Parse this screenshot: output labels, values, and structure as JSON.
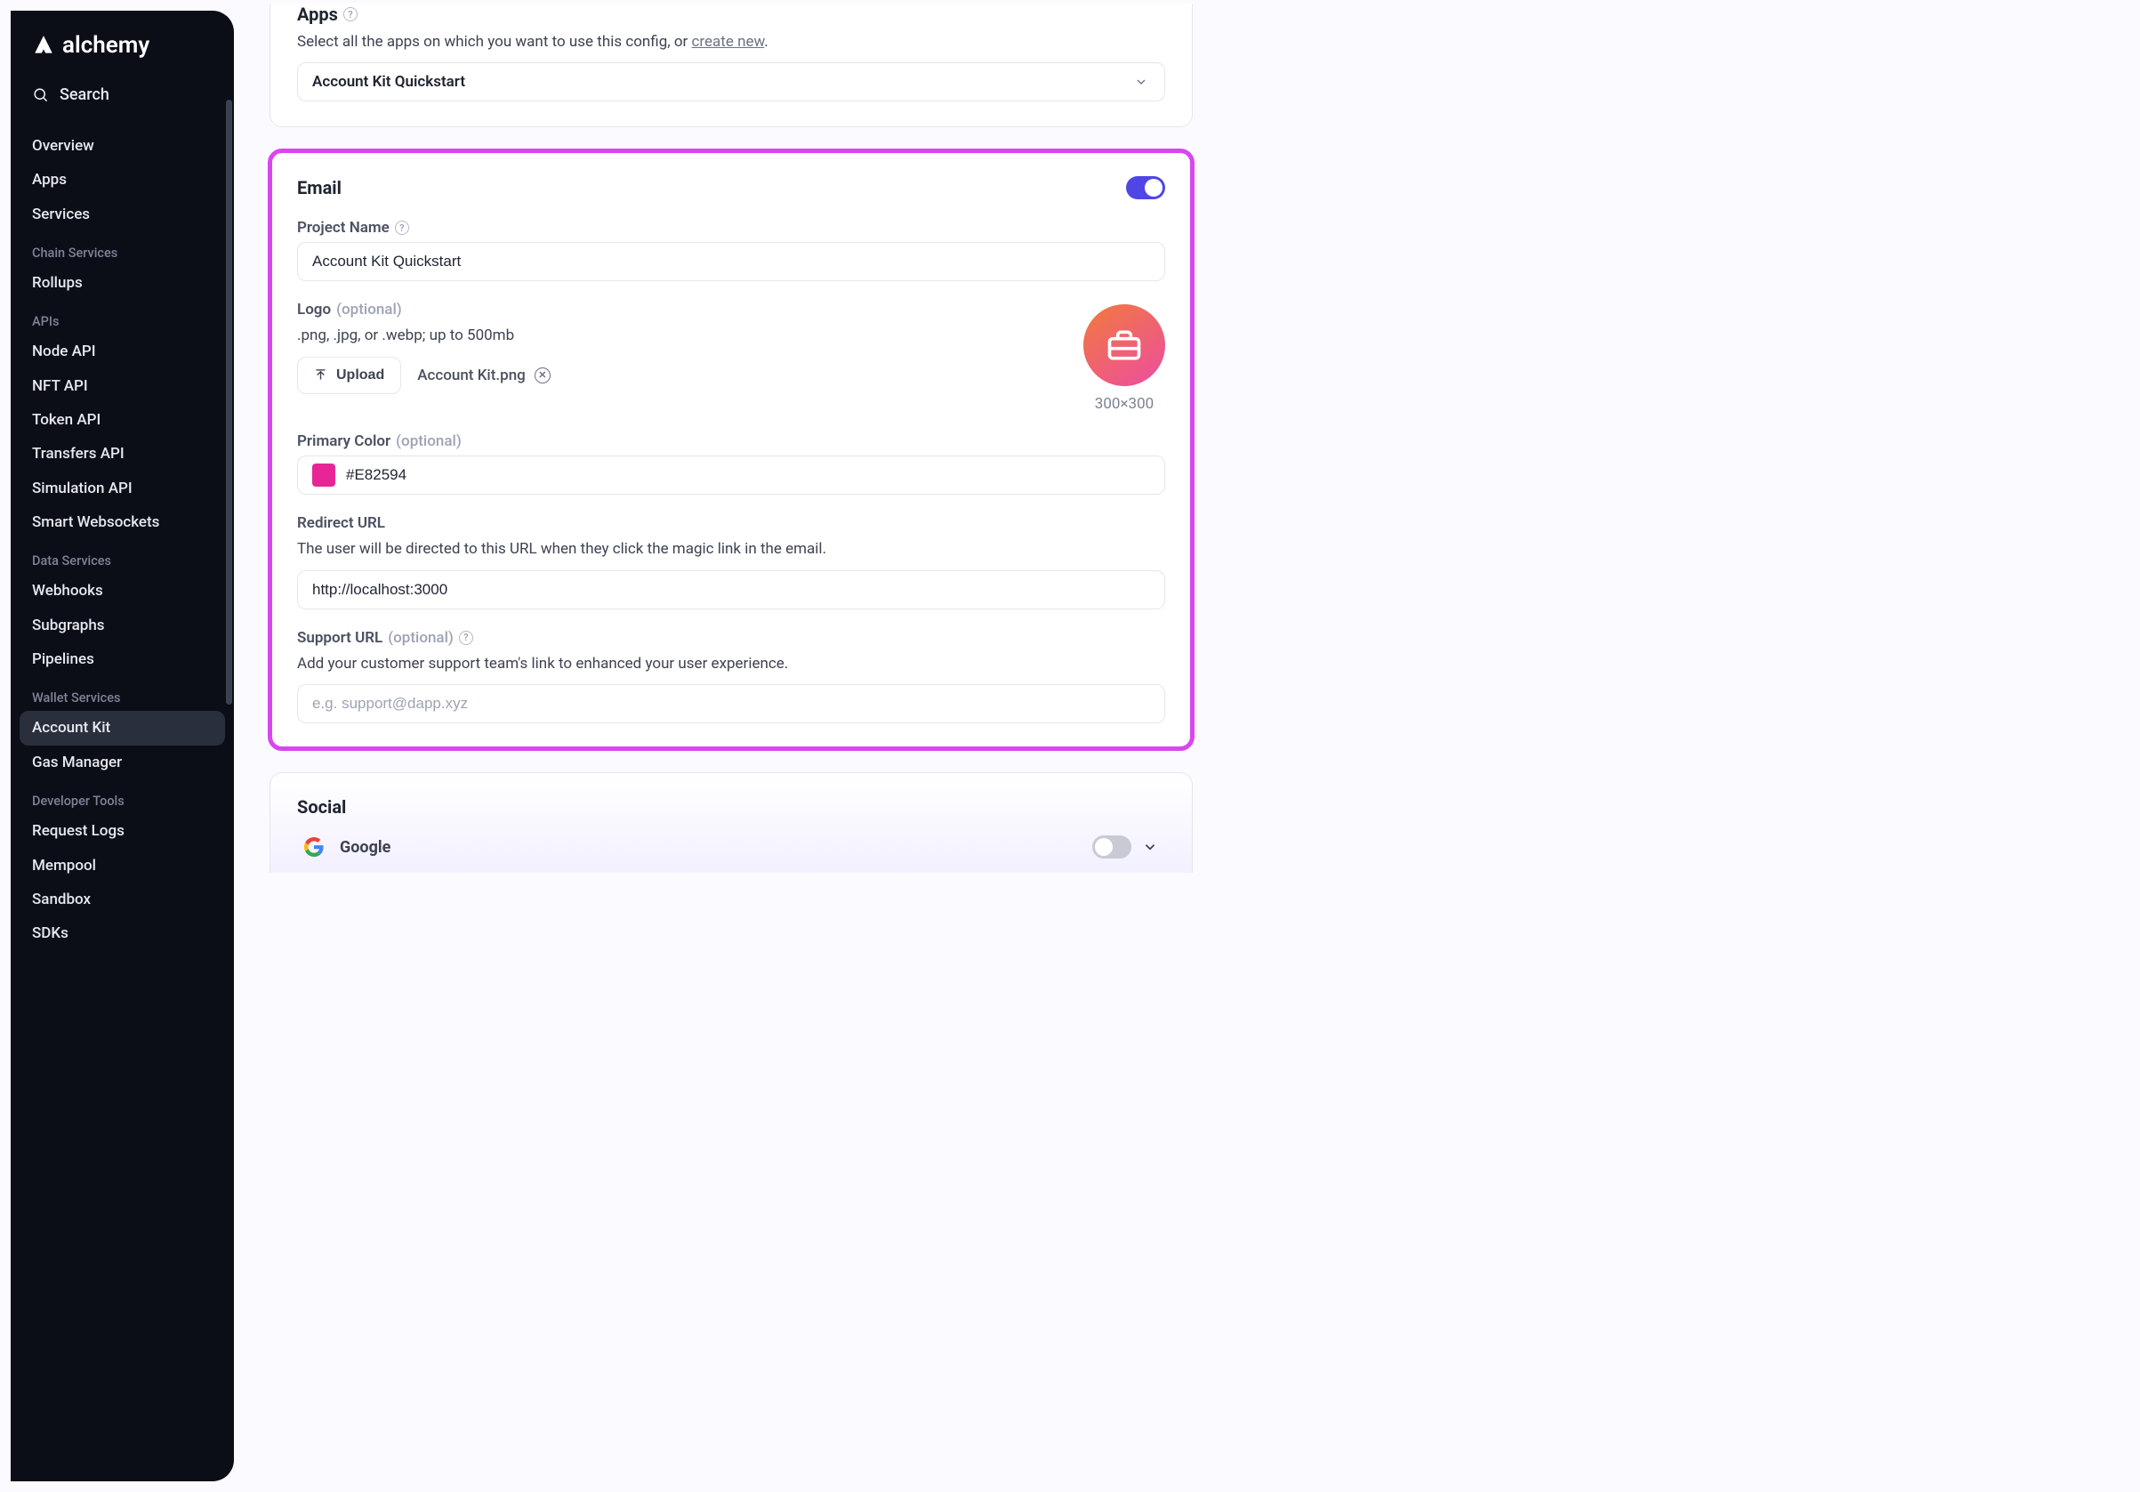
{
  "brand": {
    "name": "alchemy"
  },
  "sidebar": {
    "search_label": "Search",
    "top": [
      {
        "label": "Overview"
      },
      {
        "label": "Apps"
      },
      {
        "label": "Services"
      }
    ],
    "groups": [
      {
        "head": "Chain Services",
        "items": [
          {
            "label": "Rollups"
          }
        ]
      },
      {
        "head": "APIs",
        "items": [
          {
            "label": "Node API"
          },
          {
            "label": "NFT API"
          },
          {
            "label": "Token API"
          },
          {
            "label": "Transfers API"
          },
          {
            "label": "Simulation API"
          },
          {
            "label": "Smart Websockets"
          }
        ]
      },
      {
        "head": "Data Services",
        "items": [
          {
            "label": "Webhooks"
          },
          {
            "label": "Subgraphs"
          },
          {
            "label": "Pipelines"
          }
        ]
      },
      {
        "head": "Wallet Services",
        "items": [
          {
            "label": "Account Kit",
            "active": true
          },
          {
            "label": "Gas Manager"
          }
        ]
      },
      {
        "head": "Developer Tools",
        "items": [
          {
            "label": "Request Logs"
          },
          {
            "label": "Mempool"
          },
          {
            "label": "Sandbox"
          },
          {
            "label": "SDKs"
          }
        ]
      }
    ]
  },
  "apps": {
    "heading": "Apps",
    "description_pre": "Select all the apps on which you want to use this config, or ",
    "description_link": "create new",
    "description_post": ".",
    "selected": "Account Kit Quickstart"
  },
  "email": {
    "heading": "Email",
    "enabled": true,
    "project_name_label": "Project Name",
    "project_name_value": "Account Kit Quickstart",
    "logo_label": "Logo",
    "optional": "(optional)",
    "logo_desc": ".png, .jpg, or .webp; up to 500mb",
    "upload_label": "Upload",
    "filename": "Account Kit.png",
    "logo_dimensions": "300×300",
    "primary_color_label": "Primary Color",
    "primary_color_value": "#E82594",
    "redirect_label": "Redirect URL",
    "redirect_desc": "The user will be directed to this URL when they click the magic link in the email.",
    "redirect_value": "http://localhost:3000",
    "support_label": "Support URL",
    "support_desc": "Add your customer support team's link to enhanced your user experience.",
    "support_placeholder": "e.g. support@dapp.xyz"
  },
  "social": {
    "heading": "Social",
    "google": {
      "name": "Google",
      "enabled": false
    }
  }
}
